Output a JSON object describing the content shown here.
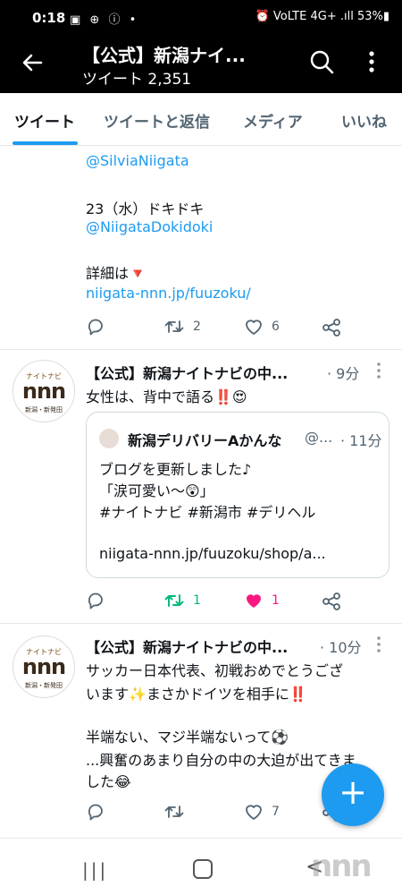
{
  "status_bar": {
    "time": "0:18",
    "left_icons": "▣ ⊕ ⓘ •",
    "right": "⏰ VoLTE 4G+ .ıll 53%▮"
  },
  "header": {
    "title": "【公式】新潟ナイ...",
    "subtitle": "ツイート 2,351"
  },
  "tabs": [
    {
      "label": "ツイート"
    },
    {
      "label": "ツイートと返信"
    },
    {
      "label": "メディア"
    },
    {
      "label": "いいね"
    }
  ],
  "tweet0": {
    "line1": "@SilviaNiigata",
    "line2": "23（水）ドキドキ",
    "line3": "@NiigataDokidoki",
    "line4": "詳細は🔻",
    "line5": "niigata-nnn.jp/fuuzoku/",
    "retweets": "2",
    "likes": "6"
  },
  "tweet1": {
    "author": "【公式】新潟ナイトナビの中...",
    "time": "· 9分",
    "text": "女性は、背中で語る‼️😍",
    "quote": {
      "author": "新潟デリバリーAかんな",
      "handle": "@...",
      "time": "· 11分",
      "line1": "ブログを更新しました♪",
      "line2": "「涙可愛い〜😲」",
      "line3": "#ナイトナビ #新潟市 #デリヘル",
      "line4": "niigata-nnn.jp/fuuzoku/shop/a..."
    },
    "retweets": "1",
    "likes": "1"
  },
  "tweet2": {
    "author": "【公式】新潟ナイトナビの中...",
    "time": "· 10分",
    "line1": "サッカー日本代表、初戦おめでとうござ",
    "line2": "います✨まさかドイツを相手に‼️",
    "line3": "半端ない、マジ半端ないって⚽",
    "line4": "...興奮のあまり自分の中の大迫が出てきま",
    "line5": "した😂",
    "likes": "7"
  },
  "avatar_logo": {
    "top": "ナイトナビ",
    "main": "nnn",
    "bottom": "新潟・新発田"
  },
  "fab": {
    "label": "+"
  },
  "navbar": {
    "recents": "|||",
    "back": "<"
  },
  "watermark": "nnn",
  "colors": {
    "accent": "#1d9bf0",
    "retweet_active": "#00ba7c",
    "like_active": "#f91880"
  }
}
